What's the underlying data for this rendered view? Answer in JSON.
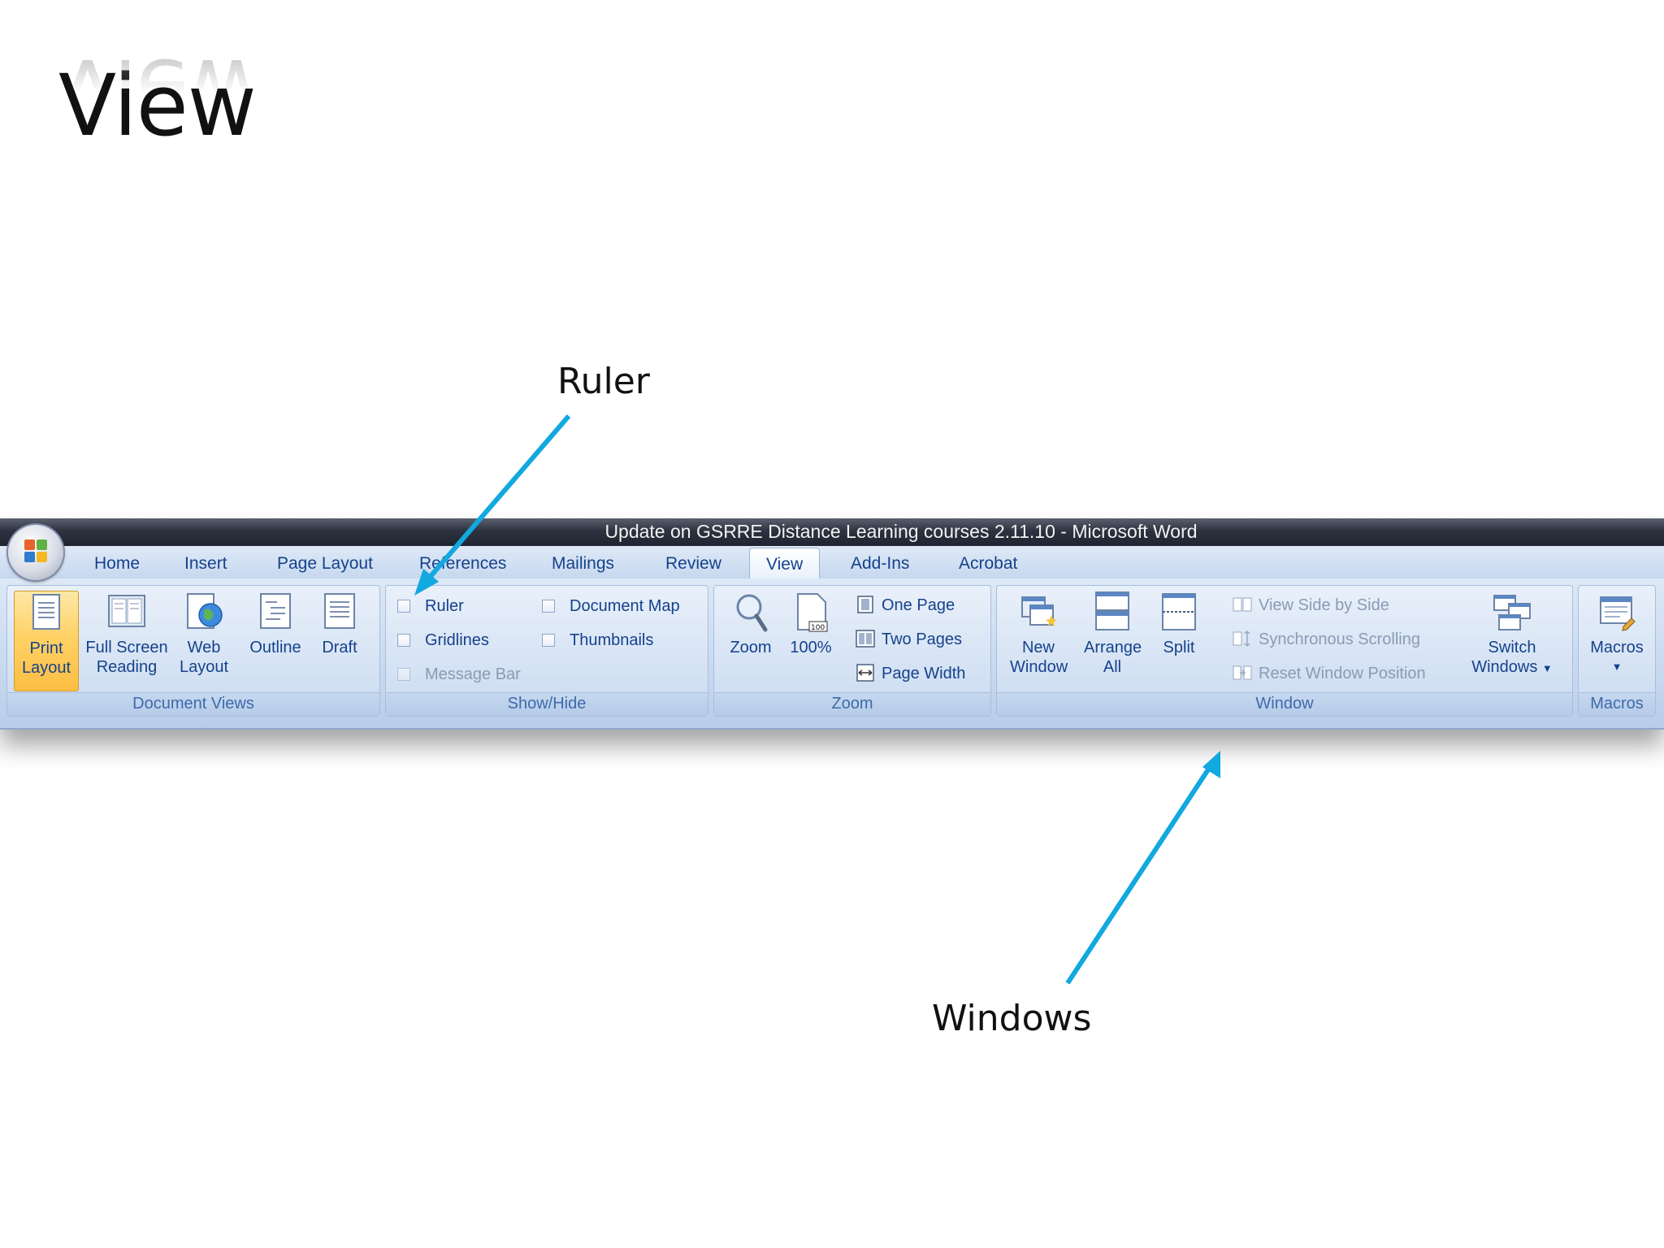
{
  "slide": {
    "title": "View",
    "annotations": {
      "ruler": "Ruler",
      "windows": "Windows"
    },
    "arrow_color": "#12a8e0"
  },
  "window": {
    "title": "Update on GSRRE Distance Learning courses 2.11.10 - Microsoft Word"
  },
  "tabs": [
    "Home",
    "Insert",
    "Page Layout",
    "References",
    "Mailings",
    "Review",
    "View",
    "Add-Ins",
    "Acrobat"
  ],
  "active_tab": "View",
  "groups": {
    "document_views": {
      "label": "Document Views",
      "buttons": {
        "print_layout": "Print Layout",
        "full_screen_reading": "Full Screen Reading",
        "web_layout": "Web Layout",
        "outline": "Outline",
        "draft": "Draft"
      }
    },
    "show_hide": {
      "label": "Show/Hide",
      "ruler": "Ruler",
      "gridlines": "Gridlines",
      "message_bar": "Message Bar",
      "document_map": "Document Map",
      "thumbnails": "Thumbnails"
    },
    "zoom": {
      "label": "Zoom",
      "zoom": "Zoom",
      "hundred": "100%",
      "one_page": "One Page",
      "two_pages": "Two Pages",
      "page_width": "Page Width"
    },
    "window": {
      "label": "Window",
      "new_window": "New Window",
      "arrange_all": "Arrange All",
      "split": "Split",
      "view_side_by_side": "View Side by Side",
      "synchronous_scrolling": "Synchronous Scrolling",
      "reset_window_position": "Reset Window Position",
      "switch_windows": "Switch Windows"
    },
    "macros": {
      "label": "Macros",
      "macros": "Macros"
    }
  },
  "colors": {
    "ribbon_text": "#15428b",
    "group_label": "#3e6aaa",
    "active_button": "#ffd267"
  }
}
